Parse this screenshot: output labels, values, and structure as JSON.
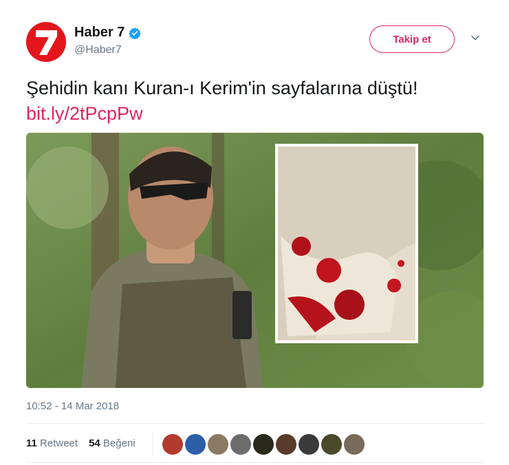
{
  "account": {
    "name": "Haber 7",
    "handle": "@Haber7",
    "verified": true,
    "avatar_icon": "haber7-logo-icon"
  },
  "follow_label": "Takip et",
  "tweet": {
    "text": "Şehidin kanı Kuran-ı Kerim'in sayfalarına düştü! ",
    "link": "bit.ly/2tPcpPw"
  },
  "timestamp": "10:52 - 14 Mar 2018",
  "stats": {
    "retweets": "11",
    "retweets_label": "Retweet",
    "likes": "54",
    "likes_label": "Beğeni"
  },
  "likers": [
    {
      "name": "liker-avatar-1",
      "color": "#b33a2e"
    },
    {
      "name": "liker-avatar-2",
      "color": "#2b5fa8"
    },
    {
      "name": "liker-avatar-3",
      "color": "#8a7a63"
    },
    {
      "name": "liker-avatar-4",
      "color": "#6d6d6d"
    },
    {
      "name": "liker-avatar-5",
      "color": "#2a2a1a"
    },
    {
      "name": "liker-avatar-6",
      "color": "#5a3a2a"
    },
    {
      "name": "liker-avatar-7",
      "color": "#3a3a3a"
    },
    {
      "name": "liker-avatar-8",
      "color": "#4a4a2a"
    },
    {
      "name": "liker-avatar-9",
      "color": "#7a6a5a"
    }
  ],
  "colors": {
    "accent": "#e0245e",
    "brand_red": "#e4161c",
    "verified_blue": "#1da1f2",
    "muted": "#657786"
  }
}
